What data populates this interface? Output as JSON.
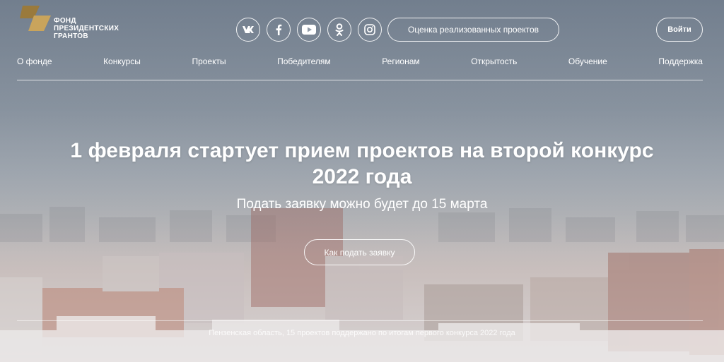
{
  "logo": {
    "lines": [
      "ФОНД",
      "ПРЕЗИДЕНТСКИХ",
      "ГРАНТОВ"
    ]
  },
  "socials": [
    "vk-icon",
    "facebook-icon",
    "youtube-icon",
    "odnoklassniki-icon",
    "instagram-icon"
  ],
  "header": {
    "rate_projects_label": "Оценка реализованных проектов",
    "login_label": "Войти"
  },
  "nav": [
    "О фонде",
    "Конкурсы",
    "Проекты",
    "Победителям",
    "Регионам",
    "Открытость",
    "Обучение",
    "Поддержка"
  ],
  "hero": {
    "title_line1": "1 февраля стартует прием проектов на второй конкурс",
    "title_line2": "2022 года",
    "subtitle": "Подать заявку можно будет до 15 марта",
    "cta_label": "Как подать заявку",
    "caption": "Пензенская область, 15 проектов поддержано по итогам первого конкурса 2022 года"
  },
  "colors": {
    "logo_gold": "#c9a45c",
    "logo_dark": "#9a7a3c",
    "text": "#ffffff"
  }
}
